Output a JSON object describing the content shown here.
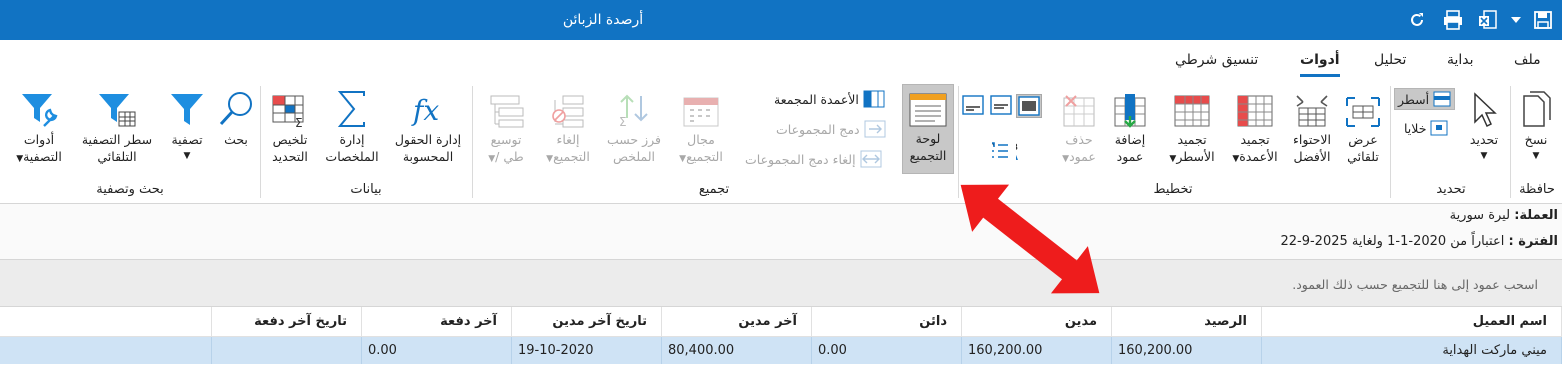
{
  "window": {
    "title": "أرصدة الزبائن"
  },
  "tabs": [
    {
      "label": "ملف",
      "active": false
    },
    {
      "label": "بداية",
      "active": false
    },
    {
      "label": "تحليل",
      "active": false
    },
    {
      "label": "أدوات",
      "active": true
    },
    {
      "label": "تنسيق شرطي",
      "active": false
    }
  ],
  "ribbon": {
    "groups": {
      "clipboard": "حافظة",
      "select": "تحديد",
      "layout": "تخطيط",
      "grouping": "تجميع",
      "data": "بيانات",
      "search_filter": "بحث وتصفية"
    },
    "copy": {
      "line1": "نسخ"
    },
    "select_btn": {
      "line1": "تحديد"
    },
    "rows_btn": "أسطر",
    "cells_btn": "خلايا",
    "auto_fit": {
      "line1": "عرض",
      "line2": "تلقائي"
    },
    "best_fit": {
      "line1": "الاحتواء",
      "line2": "الأفضل"
    },
    "freeze_cols": {
      "line1": "تجميد",
      "line2": "الأعمدة"
    },
    "freeze_rows": {
      "line1": "تجميد",
      "line2": "الأسطر"
    },
    "add_col": {
      "line1": "إضافة",
      "line2": "عمود"
    },
    "del_col": {
      "line1": "حذف",
      "line2": "عمود"
    },
    "group_panel": {
      "line1": "لوحة",
      "line2": "التجميع"
    },
    "grouped_cols": "الأعمدة المجمعة",
    "merge_groups": "دمج المجموعات",
    "unmerge_groups": "إلغاء دمج المجموعات",
    "group_range": {
      "line1": "مجال",
      "line2": "التجميع"
    },
    "sort_by_summary": {
      "line1": "فرز حسب",
      "line2": "الملخص"
    },
    "ungroup": {
      "line1": "إلغاء",
      "line2": "التجميع"
    },
    "expand": {
      "line1": "توسيع",
      "line2": "/ طي"
    },
    "summary_select": {
      "line1": "تلخيص",
      "line2": "التحديد"
    },
    "manage_summaries": {
      "line1": "إدارة",
      "line2": "الملخصات"
    },
    "calc_fields": {
      "line1": "إدارة الحقول",
      "line2": "المحسوبة"
    },
    "search": {
      "line1": "بحث"
    },
    "filter": {
      "line1": "تصفية"
    },
    "auto_filter": {
      "line1": "سطر التصفية",
      "line2": "التلقائي"
    },
    "filter_tools": {
      "line1": "أدوات",
      "line2": "التصفية"
    }
  },
  "report": {
    "currency_label": "العملة:",
    "currency_value": "ليرة سورية",
    "period_label": "الفترة :",
    "period_value": "اعتباراً من 2020-1-1 ولغاية 2025-9-22"
  },
  "group_hint": "اسحب عمود إلى هنا للتجميع حسب ذلك العمود.",
  "grid": {
    "headers": [
      "اسم العميل",
      "الرصيد",
      "مدين",
      "دائن",
      "آخر مدين",
      "تاريخ آخر مدين",
      "آخر دفعة",
      "تاريخ آخر دفعة"
    ],
    "rows": [
      [
        "ميني ماركت الهداية",
        "160,200.00",
        "160,200.00",
        "0.00",
        "80,400.00",
        "19-10-2020",
        "0.00",
        ""
      ]
    ]
  },
  "colors": {
    "title_bar": "#1173c3",
    "selected_row": "#cfe3f5",
    "annotation_arrow": "#ee1c1c"
  }
}
